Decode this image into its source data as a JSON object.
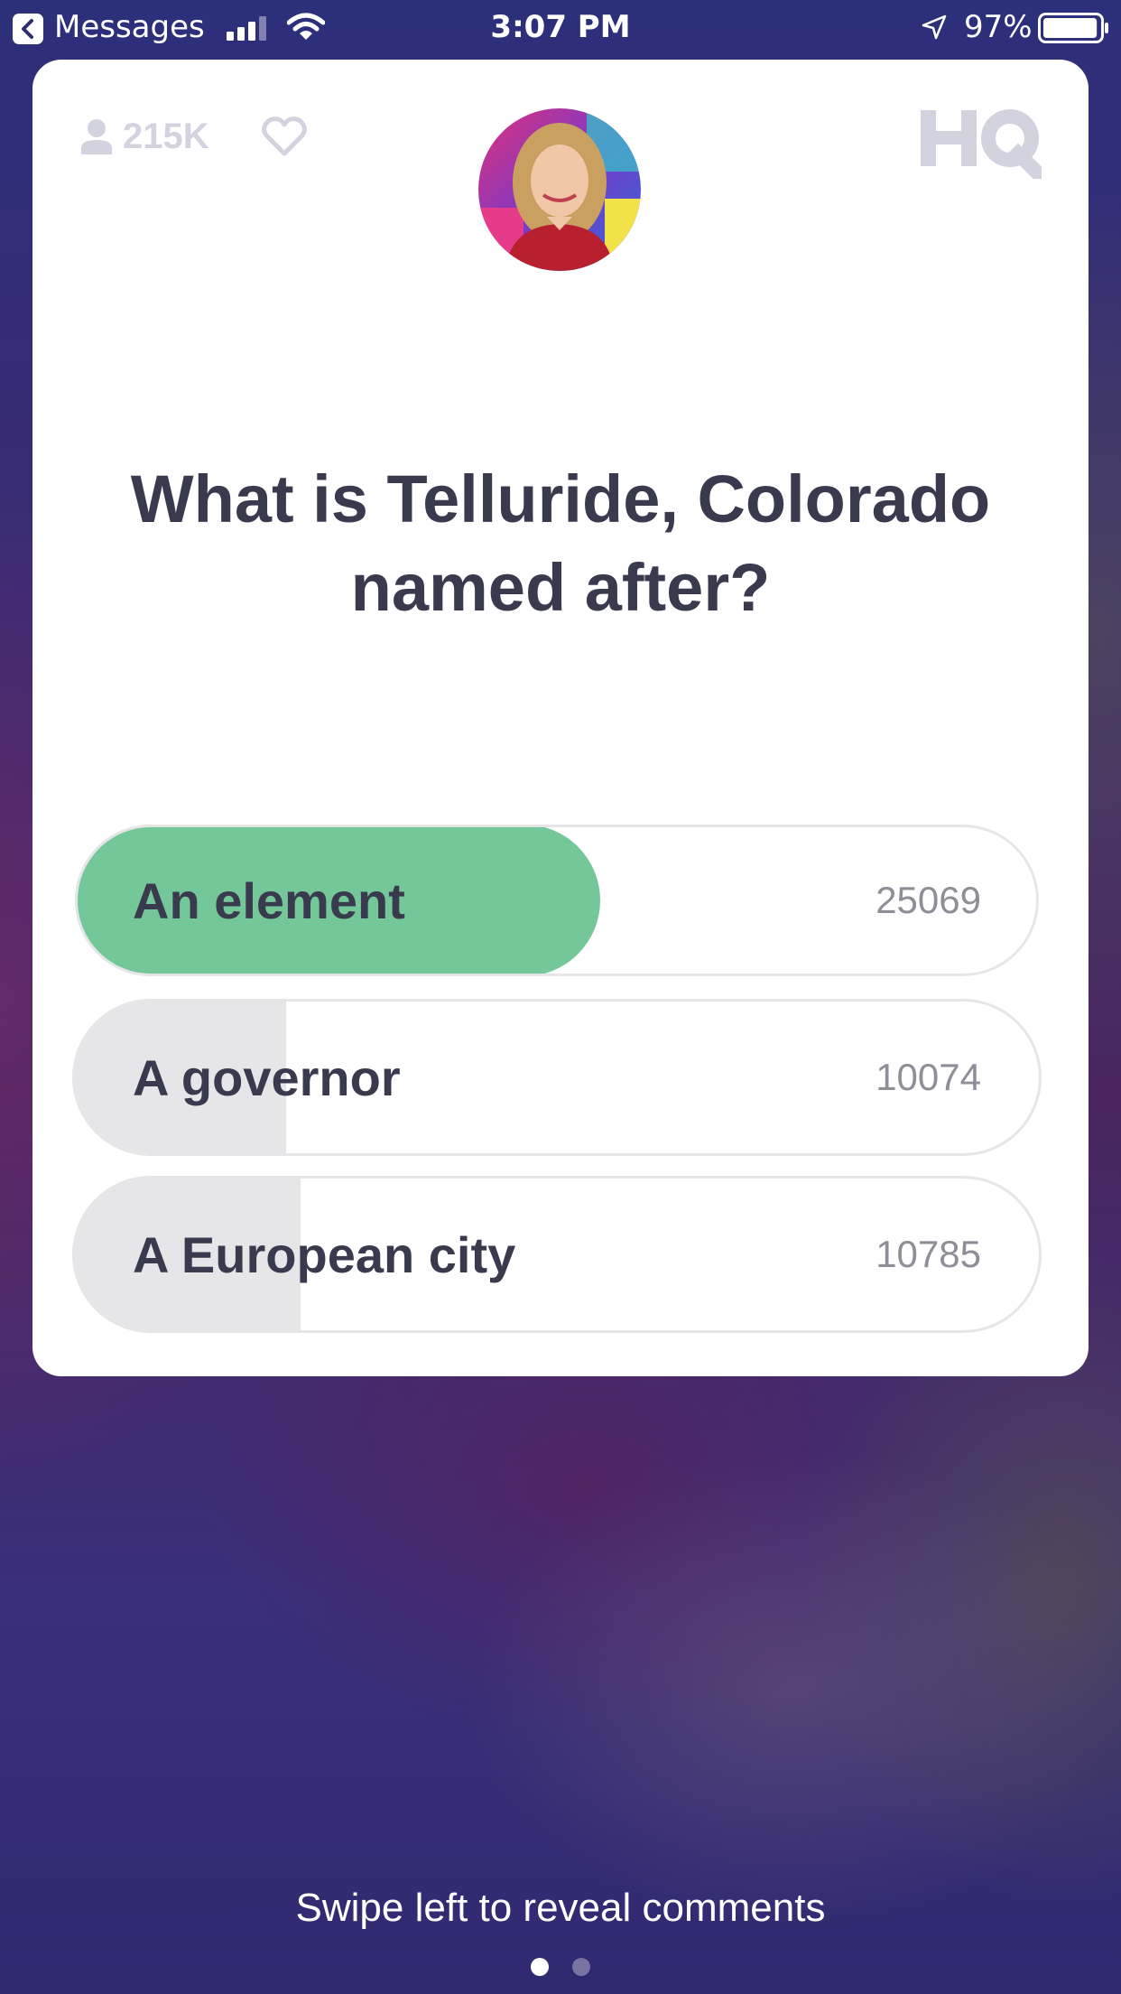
{
  "status_bar": {
    "back_label": "Messages",
    "time": "3:07 PM",
    "battery_percent": "97%",
    "battery_level": 0.97
  },
  "header": {
    "viewer_count": "215K",
    "logo_text": "HQ"
  },
  "question": {
    "text": "What is Telluride, Colorado named after?"
  },
  "answers": [
    {
      "label": "An element",
      "votes": "25069",
      "share": 0.545,
      "correct": true
    },
    {
      "label": "A governor",
      "votes": "10074",
      "share": 0.219,
      "correct": false
    },
    {
      "label": "A European city",
      "votes": "10785",
      "share": 0.234,
      "correct": false
    }
  ],
  "footer": {
    "swipe_hint": "Swipe left to reveal comments",
    "page_count": 2,
    "active_page": 1
  },
  "colors": {
    "correct_fill": "#74c798",
    "bar_fill": "#e6e6e8",
    "question_text": "#393a4e",
    "muted_icon": "#d3d3e0"
  },
  "icons": [
    "back-chevron-icon",
    "signal-icon",
    "wifi-icon",
    "location-arrow-icon",
    "battery-icon",
    "person-icon",
    "heart-icon",
    "hq-logo-icon"
  ]
}
